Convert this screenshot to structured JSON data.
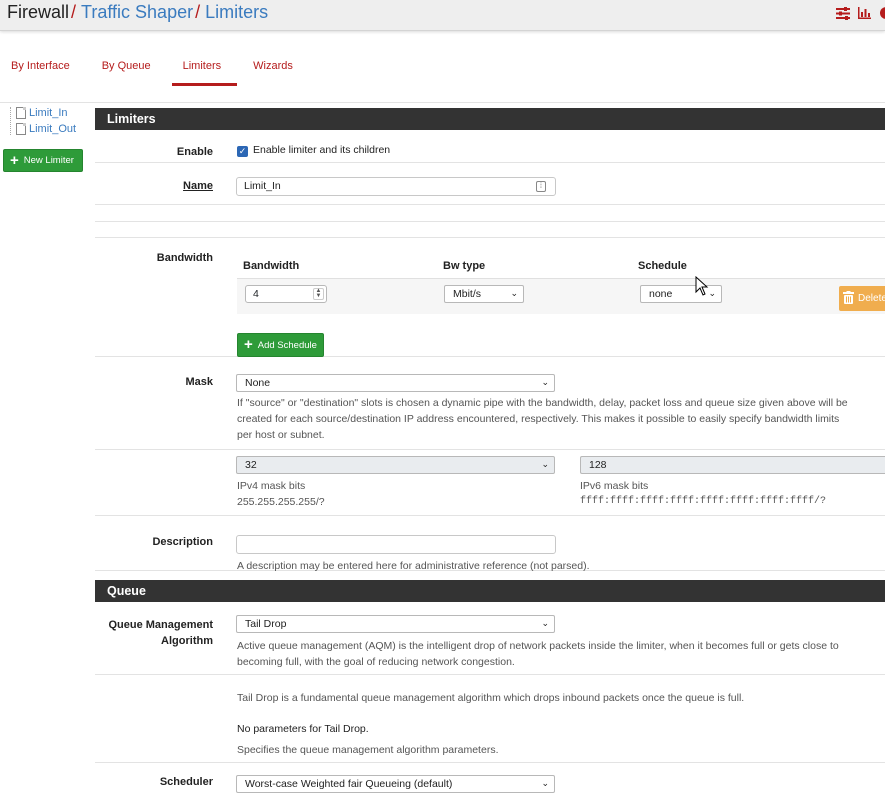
{
  "breadcrumb": {
    "root": "Firewall",
    "link1": "Traffic Shaper",
    "link2": "Limiters",
    "sep": "/"
  },
  "header_icons": [
    "sliders-icon",
    "bar-chart-icon",
    "help-icon"
  ],
  "tabs": [
    {
      "label": "By Interface",
      "active": false
    },
    {
      "label": "By Queue",
      "active": false
    },
    {
      "label": "Limiters",
      "active": true
    },
    {
      "label": "Wizards",
      "active": false
    }
  ],
  "tree": {
    "items": [
      "Limit_In",
      "Limit_Out"
    ],
    "new_button": "New Limiter"
  },
  "limiters": {
    "heading": "Limiters",
    "enable": {
      "label": "Enable",
      "checkbox_label": "Enable limiter and its children",
      "checked": true
    },
    "name": {
      "label": "Name",
      "value": "Limit_In"
    },
    "bandwidth": {
      "label": "Bandwidth",
      "col_bandwidth": "Bandwidth",
      "col_bwtype": "Bw type",
      "col_schedule": "Schedule",
      "value": "4",
      "bwtype": "Mbit/s",
      "schedule": "none",
      "delete_label": "Delete",
      "add_schedule": "Add Schedule"
    },
    "mask": {
      "label": "Mask",
      "value": "None",
      "help1": "If \"source\" or \"destination\" slots is chosen a dynamic pipe with the bandwidth, delay, packet loss and queue size given above will be",
      "help2": "created for each source/destination IP address encountered, respectively. This makes it possible to easily specify bandwidth limits",
      "help3": "per host or subnet.",
      "ipv4_value": "32",
      "ipv4_label": "IPv4 mask bits",
      "ipv4_hint": "255.255.255.255/?",
      "ipv6_value": "128",
      "ipv6_label": "IPv6 mask bits",
      "ipv6_hint": "ffff:ffff:ffff:ffff:ffff:ffff:ffff:ffff/?"
    },
    "description": {
      "label": "Description",
      "value": "",
      "help": "A description may be entered here for administrative reference (not parsed)."
    }
  },
  "queue": {
    "heading": "Queue",
    "aqm": {
      "label_line1": "Queue Management",
      "label_line2": "Algorithm",
      "value": "Tail Drop",
      "help1": "Active queue management (AQM) is the intelligent drop of network packets inside the limiter, when it becomes full or gets close to",
      "help2": "becoming full, with the goal of reducing network congestion."
    },
    "taildrop_info": "Tail Drop is a fundamental queue management algorithm which drops inbound packets once the queue is full.",
    "no_params": "No parameters for Tail Drop.",
    "params_help": "Specifies the queue management algorithm parameters.",
    "scheduler": {
      "label": "Scheduler",
      "value": "Worst-case Weighted fair Queueing (default)"
    }
  },
  "colors": {
    "brand_red": "#b51c1c",
    "link_blue": "#3a7bbf",
    "green": "#2e9b39",
    "orange": "#f0ad4e",
    "panel_dark": "#333333"
  }
}
